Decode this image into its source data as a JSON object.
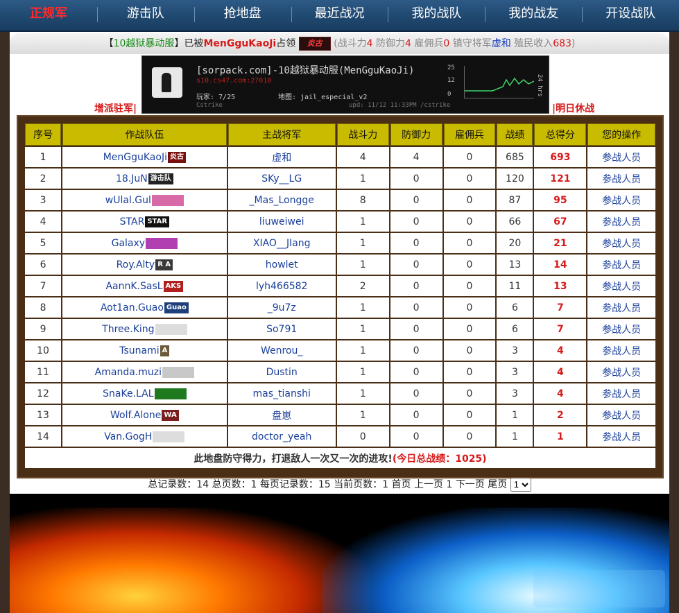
{
  "nav": {
    "items": [
      {
        "label": "正规军",
        "active": true
      },
      {
        "label": "游击队"
      },
      {
        "label": "抢地盘"
      },
      {
        "label": "最近战况"
      },
      {
        "label": "我的战队"
      },
      {
        "label": "我的战友"
      },
      {
        "label": "开设战队"
      }
    ]
  },
  "announce": {
    "server": "10越狱暴动服",
    "occupied_by": "已被",
    "team": "MenGguKaoJi",
    "occupy": "占领",
    "combat_label": "战斗力",
    "combat": "4",
    "defense_label": "防御力",
    "defense": "4",
    "merc_label": "雇佣兵",
    "merc": "0",
    "general_label": "镇守将军",
    "general": "虚和",
    "income_label": "殖民收入",
    "income": "683"
  },
  "banner": {
    "title": "[sorpack.com]-10越狱暴动服(MenGguKaoJi)",
    "address": "s10.cs47.com:27010",
    "players": "玩家: 7/25",
    "map": "地图: jail_especial_v2",
    "game": "Cstrike",
    "updated": "upd: 11/12 11:33PM /cstrike",
    "graph_ticks": [
      "25",
      "12",
      "0"
    ],
    "graph_caption": "24 hrs"
  },
  "links": {
    "reinforce": "增派驻军|",
    "truce": "|明日休战"
  },
  "table": {
    "headers": [
      "序号",
      "作战队伍",
      "主战将军",
      "战斗力",
      "防御力",
      "雇佣兵",
      "战绩",
      "总得分",
      "您的操作"
    ],
    "rows": [
      {
        "no": "1",
        "team": "MenGguKaoJi",
        "tag": "炎古",
        "tagColor": "#7a0f0f",
        "general": "虚和",
        "combat": "4",
        "defense": "4",
        "merc": "0",
        "record": "685",
        "total": "693",
        "op": "参战人员"
      },
      {
        "no": "2",
        "team": "18.JuN",
        "tag": "游击队",
        "tagColor": "#222222",
        "general": "SKy__LG",
        "combat": "1",
        "defense": "0",
        "merc": "0",
        "record": "120",
        "total": "121",
        "op": "参战人员"
      },
      {
        "no": "3",
        "team": "wUlal.Gul",
        "tag": "",
        "tagColor": "#d86aa8",
        "general": "_Mas_Longge",
        "combat": "8",
        "defense": "0",
        "merc": "0",
        "record": "87",
        "total": "95",
        "op": "参战人员"
      },
      {
        "no": "4",
        "team": "STAR",
        "tag": "STAR",
        "tagColor": "#111111",
        "general": "liuweiwei",
        "combat": "1",
        "defense": "0",
        "merc": "0",
        "record": "66",
        "total": "67",
        "op": "参战人员"
      },
      {
        "no": "5",
        "team": "Galaxy",
        "tag": "",
        "tagColor": "#b23fb2",
        "general": "XIAO__JIang",
        "combat": "1",
        "defense": "0",
        "merc": "0",
        "record": "20",
        "total": "21",
        "op": "参战人员"
      },
      {
        "no": "6",
        "team": "Roy.Alty",
        "tag": "R A",
        "tagColor": "#3a3a3a",
        "general": "howlet",
        "combat": "1",
        "defense": "0",
        "merc": "0",
        "record": "13",
        "total": "14",
        "op": "参战人员"
      },
      {
        "no": "7",
        "team": "AannK.SasL",
        "tag": "AKS",
        "tagColor": "#b21f1f",
        "general": "lyh466582",
        "combat": "2",
        "defense": "0",
        "merc": "0",
        "record": "11",
        "total": "13",
        "op": "参战人员"
      },
      {
        "no": "8",
        "team": "Aot1an.Guao",
        "tag": "Guao",
        "tagColor": "#1f3f7a",
        "general": "_9u7z",
        "combat": "1",
        "defense": "0",
        "merc": "0",
        "record": "6",
        "total": "7",
        "op": "参战人员"
      },
      {
        "no": "9",
        "team": "Three.King",
        "tag": "",
        "tagColor": "#dddddd",
        "general": "So791",
        "combat": "1",
        "defense": "0",
        "merc": "0",
        "record": "6",
        "total": "7",
        "op": "参战人员"
      },
      {
        "no": "10",
        "team": "Tsunami",
        "tag": "A",
        "tagColor": "#6a5a3a",
        "general": "Wenrou_",
        "combat": "1",
        "defense": "0",
        "merc": "0",
        "record": "3",
        "total": "4",
        "op": "参战人员"
      },
      {
        "no": "11",
        "team": "Amanda.muzi",
        "tag": "",
        "tagColor": "#c8c8c8",
        "general": "Dustin",
        "combat": "1",
        "defense": "0",
        "merc": "0",
        "record": "3",
        "total": "4",
        "op": "参战人员"
      },
      {
        "no": "12",
        "team": "SnaKe.LAL",
        "tag": "",
        "tagColor": "#1f7a1f",
        "general": "mas_tianshi",
        "combat": "1",
        "defense": "0",
        "merc": "0",
        "record": "3",
        "total": "4",
        "op": "参战人员"
      },
      {
        "no": "13",
        "team": "Wolf.Alone",
        "tag": "WA",
        "tagColor": "#7a1f1f",
        "general": "盘崽",
        "combat": "1",
        "defense": "0",
        "merc": "0",
        "record": "1",
        "total": "2",
        "op": "参战人员"
      },
      {
        "no": "14",
        "team": "Van.GogH",
        "tag": "",
        "tagColor": "#dddddd",
        "general": "doctor_yeah",
        "combat": "0",
        "defense": "0",
        "merc": "0",
        "record": "1",
        "total": "1",
        "op": "参战人员"
      }
    ],
    "footer_text": "此地盘防守得力，打退敌人一次又一次的进攻!",
    "footer_total": "(今日总战绩：1025)"
  },
  "pager": {
    "text": "总记录数：14 总页数：1 每页记录数：15 当前页数：1",
    "first": "首页",
    "prev": "上一页",
    "page": "1",
    "next": "下一页",
    "last": "尾页",
    "selected": "1"
  }
}
